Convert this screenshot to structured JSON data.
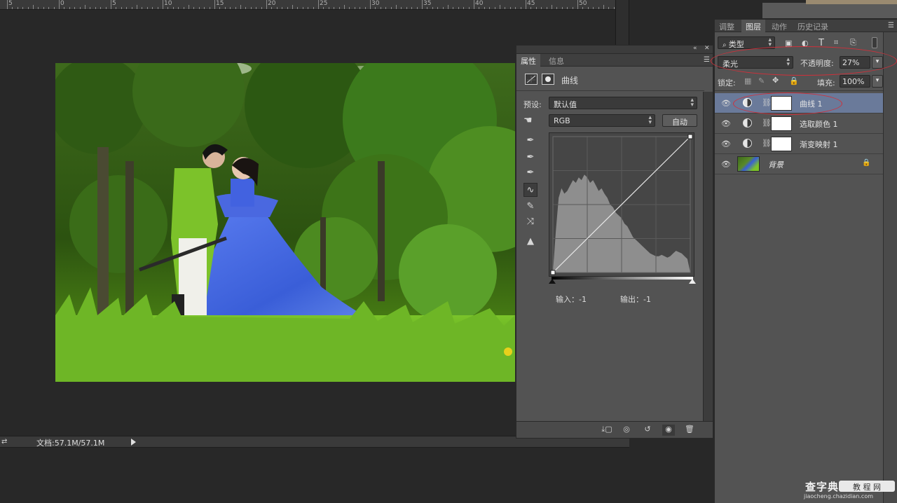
{
  "ruler": {
    "labels": [
      "5",
      "0",
      "5",
      "10",
      "15",
      "20",
      "25",
      "30",
      "35",
      "40",
      "45",
      "50"
    ]
  },
  "status_bar": {
    "doc_info": "文档:57.1M/57.1M"
  },
  "properties_panel": {
    "tabs": [
      {
        "label": "属性",
        "active": true
      },
      {
        "label": "信息",
        "active": false
      }
    ],
    "adjustment_title": "曲线",
    "preset_label": "预设:",
    "preset_value": "默认值",
    "channel_value": "RGB",
    "auto_button": "自动",
    "input_readout": "输入：-1",
    "output_readout": "输出：-1",
    "tools": [
      "eyedropper-black-icon",
      "eyedropper-gray-icon",
      "eyedropper-white-icon",
      "curve-point-icon",
      "pencil-icon",
      "smooth-icon",
      "clipping-warning-icon"
    ],
    "bottom_icons": [
      "clip-to-layer-icon",
      "view-previous-icon",
      "reset-icon",
      "visibility-icon",
      "trash-icon"
    ],
    "histogram": [
      0.0,
      0.3,
      0.55,
      0.62,
      0.58,
      0.6,
      0.64,
      0.68,
      0.66,
      0.7,
      0.68,
      0.72,
      0.7,
      0.66,
      0.68,
      0.64,
      0.6,
      0.62,
      0.58,
      0.55,
      0.5,
      0.48,
      0.44,
      0.42,
      0.4,
      0.36,
      0.34,
      0.3,
      0.26,
      0.24,
      0.22,
      0.2,
      0.18,
      0.16,
      0.14,
      0.13,
      0.12,
      0.12,
      0.13,
      0.12,
      0.11,
      0.12,
      0.14,
      0.16,
      0.15,
      0.14,
      0.12,
      0.1,
      0.0
    ],
    "curve_input": -1,
    "curve_output": -1
  },
  "layers_panel": {
    "tabs": [
      {
        "label": "调整",
        "active": false
      },
      {
        "label": "图层",
        "active": true
      },
      {
        "label": "动作",
        "active": false
      },
      {
        "label": "历史记录",
        "active": false
      }
    ],
    "filter_kind": "类型",
    "filter_icons": [
      "image-filter-icon",
      "adjustment-filter-icon",
      "type-filter-icon",
      "shape-filter-icon",
      "smart-object-filter-icon"
    ],
    "blend_mode": "柔光",
    "opacity_label": "不透明度:",
    "opacity_value": "27%",
    "lock_label": "锁定:",
    "fill_label": "填充:",
    "fill_value": "100%",
    "layers": [
      {
        "name": "曲线 1",
        "type": "adjustment",
        "selected": true
      },
      {
        "name": "选取颜色 1",
        "type": "adjustment",
        "selected": false
      },
      {
        "name": "渐变映射 1",
        "type": "adjustment",
        "selected": false
      },
      {
        "name": "背景",
        "type": "background",
        "selected": false
      }
    ]
  },
  "watermark": {
    "brand": "查字典",
    "sub": "教 程 网",
    "url": "jiaocheng.chazidian.com"
  },
  "colors": {
    "workspace": "#282828",
    "panel": "#535353",
    "selection": "#6a7a9a",
    "annotation_red": "#d0303a",
    "dress_blue": "#3a5ed8",
    "jacket_green": "#7cc22a"
  }
}
